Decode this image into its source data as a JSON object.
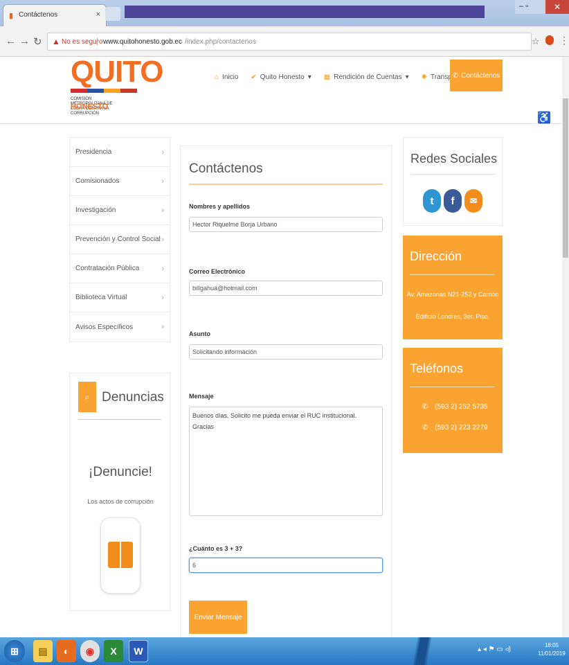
{
  "browser": {
    "tab_title": "Contáctenos",
    "tab_close": "×",
    "security_label": "No es seguro",
    "url_domain": "www.quitohonesto.gob.ec",
    "url_path": "/index.php/contactenos"
  },
  "site": {
    "logo_word": "QUITO",
    "logo_subtitle": "HONESTO",
    "logo_prefix": "COMISIÓN METROPOLITANA DE LUCHA CONTRA LA CORRUPCIÓN",
    "nav": [
      {
        "label": "Inicio",
        "icon": "home-icon"
      },
      {
        "label": "Quito Honesto",
        "icon": "check-icon",
        "caret": "▾"
      },
      {
        "label": "Rendición de Cuentas",
        "icon": "building-icon",
        "caret": "▾"
      },
      {
        "label": "Transparencia",
        "icon": "sun-icon",
        "caret": "▾"
      }
    ],
    "contact_button": "Contáctenos"
  },
  "left_menu": [
    "Presidencia",
    "Comisionados",
    "Investigación",
    "Prevención y Control Social",
    "Contratación Pública",
    "Biblioteca Virtual",
    "Avisos Específicos"
  ],
  "denuncias": {
    "title": "Denuncias",
    "headline": "¡Denuncie!",
    "subtitle": "Los actos de corrupción"
  },
  "form": {
    "title": "Contáctenos",
    "name_label": "Nombres y apellidos",
    "name_value": "Hector Riquelme Borja Urbano",
    "email_label": "Correo Electrónico",
    "email_value": "billgahua@hotmail.com",
    "subject_label": "Asunto",
    "subject_value": "Solicitando información",
    "message_label": "Mensaje",
    "message_value": "Buenos días. Solicito me pueda enviar el RUC institucional.\nGracias",
    "captcha_label": "¿Cuánto es 3 + 3?",
    "captcha_value": "6",
    "submit_label": "Enviar Mensaje"
  },
  "social": {
    "title": "Redes Sociales"
  },
  "address": {
    "title": "Dirección",
    "line1": "Av. Amazonas N21-252 y Carrión",
    "line2": "Edificio Londres, 3er. Piso."
  },
  "phones": {
    "title": "Teléfonos",
    "numbers": [
      "(593 2) 252 5735",
      "(593 2) 223 2279"
    ]
  },
  "taskbar": {
    "clock_time": "18:05",
    "clock_date": "11/01/2019"
  },
  "colors": {
    "accent": "#f8a332",
    "logo_orange": "#f26e22",
    "twitter": "#2f96d4",
    "facebook": "#3b5b98"
  }
}
